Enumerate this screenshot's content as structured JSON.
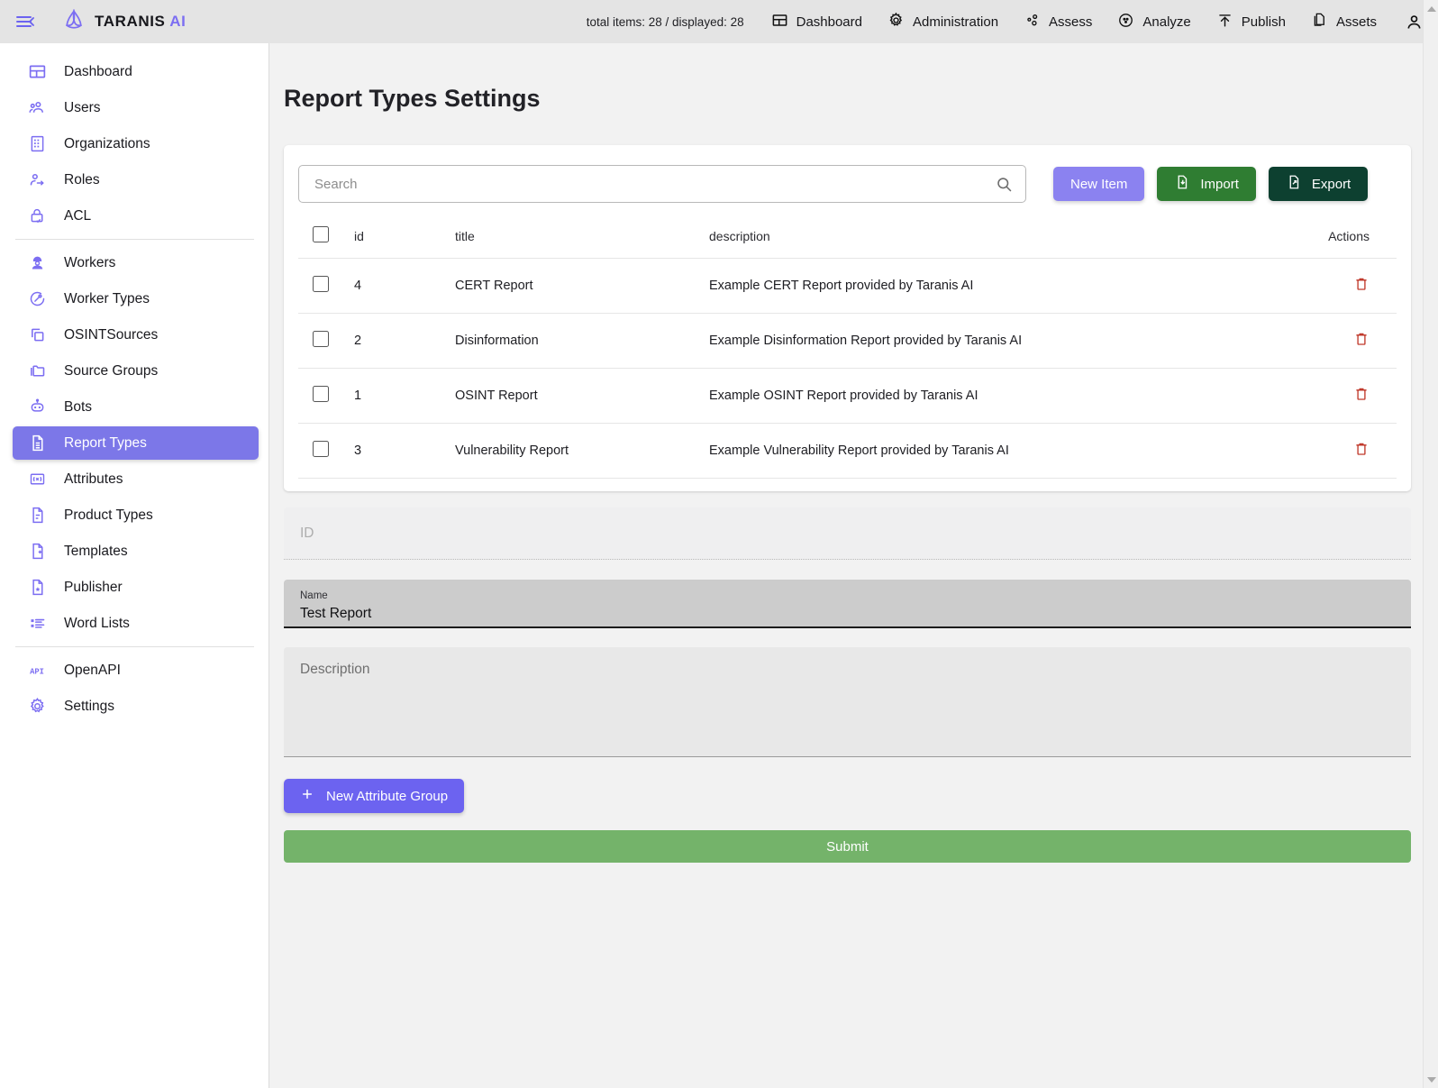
{
  "topbar": {
    "menu_icon": "hamburger-collapse-icon",
    "brand_name": "TARANIS",
    "brand_suffix": "AI",
    "brand_logo_icon": "taranis-triquetra-logo-icon",
    "counter": "total items: 28 / displayed: 28",
    "nav": [
      {
        "label": "Dashboard",
        "icon": "dashboard-grid-icon"
      },
      {
        "label": "Administration",
        "icon": "gear-icon"
      },
      {
        "label": "Assess",
        "icon": "assess-nodes-icon"
      },
      {
        "label": "Analyze",
        "icon": "analyze-target-icon"
      },
      {
        "label": "Publish",
        "icon": "upload-arrow-icon"
      },
      {
        "label": "Assets",
        "icon": "documents-copy-icon"
      }
    ],
    "account_icon": "user-account-icon"
  },
  "sidebar": {
    "items": [
      {
        "label": "Dashboard",
        "icon": "dashboard-grid-icon",
        "active": false
      },
      {
        "label": "Users",
        "icon": "users-group-icon",
        "active": false
      },
      {
        "label": "Organizations",
        "icon": "building-icon",
        "active": false
      },
      {
        "label": "Roles",
        "icon": "person-arrow-icon",
        "active": false
      },
      {
        "label": "ACL",
        "icon": "lock-check-icon",
        "active": false
      },
      {
        "label": "Workers",
        "icon": "worker-helmet-icon",
        "active": false
      },
      {
        "label": "Worker Types",
        "icon": "worker-type-dial-icon",
        "active": false
      },
      {
        "label": "OSINTSources",
        "icon": "copy-stack-icon",
        "active": false
      },
      {
        "label": "Source Groups",
        "icon": "folder-icon",
        "active": false
      },
      {
        "label": "Bots",
        "icon": "robot-icon",
        "active": false
      },
      {
        "label": "Report Types",
        "icon": "report-document-icon",
        "active": true
      },
      {
        "label": "Attributes",
        "icon": "variable-x-icon",
        "active": false
      },
      {
        "label": "Product Types",
        "icon": "document-lines-icon",
        "active": false
      },
      {
        "label": "Templates",
        "icon": "document-plus-icon",
        "active": false
      },
      {
        "label": "Publisher",
        "icon": "document-star-icon",
        "active": false
      },
      {
        "label": "Word Lists",
        "icon": "list-bullets-icon",
        "active": false
      },
      {
        "label": "OpenAPI",
        "icon": "api-icon",
        "active": false
      },
      {
        "label": "Settings",
        "icon": "gear-icon",
        "active": false
      }
    ],
    "separator_after": [
      4,
      15
    ]
  },
  "page": {
    "title": "Report Types Settings"
  },
  "search": {
    "placeholder": "Search",
    "value": "",
    "icon": "search-magnifier-icon"
  },
  "toolbar": {
    "new_item_label": "New Item",
    "import_label": "Import",
    "export_label": "Export",
    "import_icon": "file-import-icon",
    "export_icon": "file-export-icon"
  },
  "table": {
    "columns": [
      "id",
      "title",
      "description",
      "Actions"
    ],
    "select_all_checked": false,
    "row_action_icon": "trash-delete-icon",
    "rows": [
      {
        "checked": false,
        "id": "4",
        "title": "CERT Report",
        "description": "Example CERT Report provided by Taranis AI"
      },
      {
        "checked": false,
        "id": "2",
        "title": "Disinformation",
        "description": "Example Disinformation Report provided by Taranis AI"
      },
      {
        "checked": false,
        "id": "1",
        "title": "OSINT Report",
        "description": "Example OSINT Report provided by Taranis AI"
      },
      {
        "checked": false,
        "id": "3",
        "title": "Vulnerability Report",
        "description": "Example Vulnerability Report provided by Taranis AI"
      }
    ]
  },
  "form": {
    "id_field": {
      "placeholder": "ID",
      "value": "",
      "disabled": true
    },
    "name_field": {
      "label": "Name",
      "value": "Test Report",
      "focused": true
    },
    "desc_field": {
      "placeholder": "Description",
      "value": ""
    },
    "new_attribute_group_label": "New Attribute Group",
    "new_attribute_group_icon": "plus-icon",
    "submit_label": "Submit"
  },
  "colors": {
    "brand_purple": "#7c6ef2",
    "sidebar_active": "#7c77e8",
    "import_green": "#2f7d32",
    "export_dark_green": "#0d4030",
    "submit_green": "#74b36a",
    "delete_red": "#c0392b",
    "topbar_gray": "#e4e4e4",
    "page_bg": "#f2f2f2"
  },
  "scrollbar": {
    "up_icon": "triangle-up-icon",
    "down_icon": "triangle-down-icon"
  }
}
